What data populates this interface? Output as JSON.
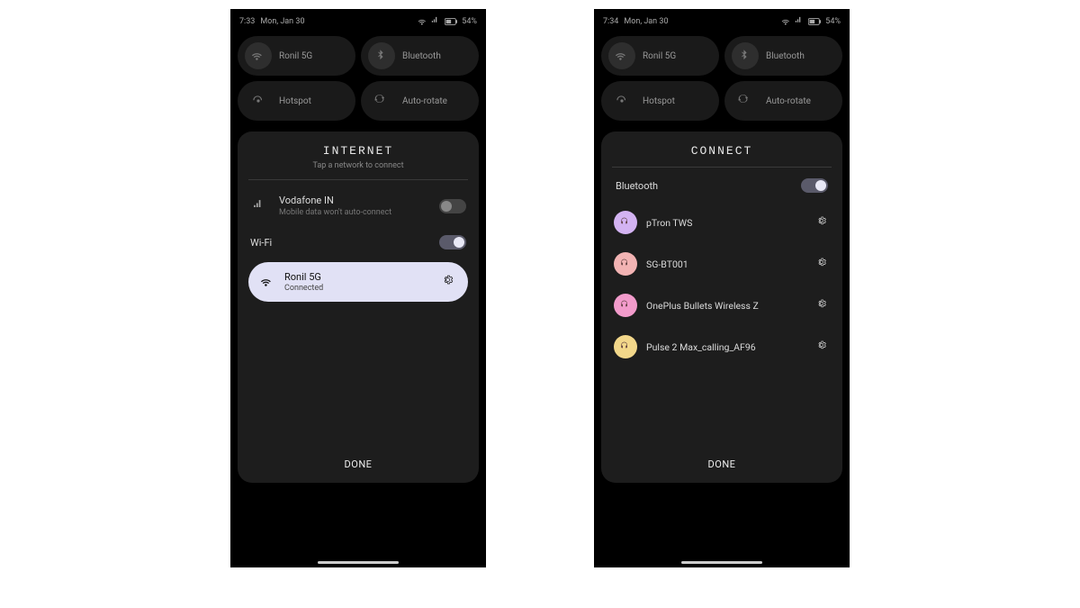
{
  "left": {
    "status": {
      "time": "7:33",
      "date": "Mon, Jan 30",
      "battery": "54%"
    },
    "tiles": {
      "wifi": "Ronil 5G",
      "bluetooth": "Bluetooth",
      "hotspot": "Hotspot",
      "autorotate": "Auto-rotate"
    },
    "panel": {
      "title": "INTERNET",
      "subtitle": "Tap a network to connect",
      "carrier": {
        "name": "Vodafone IN",
        "note": "Mobile data won't auto-connect"
      },
      "wifi_label": "Wi-Fi",
      "network": {
        "ssid": "Ronil 5G",
        "status": "Connected"
      },
      "done": "DONE"
    }
  },
  "right": {
    "status": {
      "time": "7:34",
      "date": "Mon, Jan 30",
      "battery": "54%"
    },
    "tiles": {
      "wifi": "Ronil 5G",
      "bluetooth": "Bluetooth",
      "hotspot": "Hotspot",
      "autorotate": "Auto-rotate"
    },
    "panel": {
      "title": "CONNECT",
      "bt_label": "Bluetooth",
      "devices": [
        {
          "name": "pTron TWS",
          "color": "#d3b3f2"
        },
        {
          "name": "SG-BT001",
          "color": "#f2b3b3"
        },
        {
          "name": "OnePlus Bullets Wireless Z",
          "color": "#f29bcb"
        },
        {
          "name": "Pulse 2 Max_calling_AF96",
          "color": "#f2d78a"
        }
      ],
      "done": "DONE"
    }
  }
}
